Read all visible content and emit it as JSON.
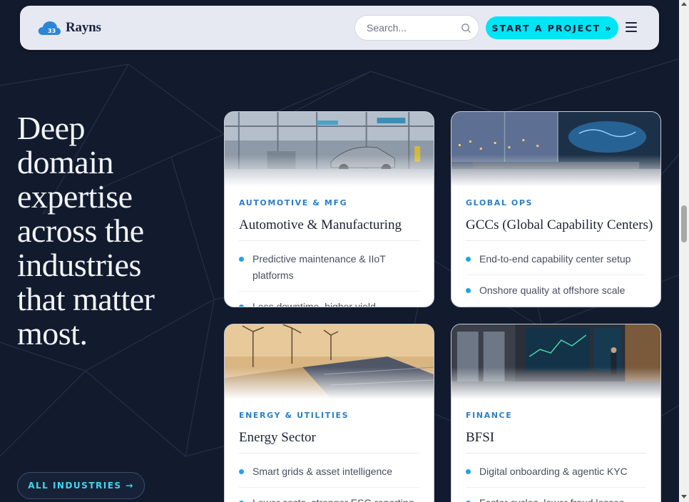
{
  "header": {
    "brand": "Rayns",
    "search_placeholder": "Search...",
    "cta_label": "START A PROJECT »",
    "menu_icon": "hamburger-menu-icon"
  },
  "hero": {
    "heading_lines": [
      "Deep",
      "domain",
      "expertise",
      "across the",
      "industries",
      "that matter",
      "most."
    ],
    "button_label": "ALL INDUSTRIES →"
  },
  "cards": [
    {
      "tag": "AUTOMOTIVE & MFG",
      "title": "Automotive & Manufacturing",
      "bullets": [
        "Predictive maintenance & IIoT platforms",
        "Less downtime, higher yield"
      ]
    },
    {
      "tag": "GLOBAL OPS",
      "title": "GCCs (Global Capability Centers)",
      "bullets": [
        "End-to-end capability center setup",
        "Onshore quality at offshore scale"
      ]
    },
    {
      "tag": "ENERGY & UTILITIES",
      "title": "Energy Sector",
      "bullets": [
        "Smart grids & asset intelligence",
        "Lower costs, stronger ESG reporting"
      ]
    },
    {
      "tag": "FINANCE",
      "title": "BFSI",
      "bullets": [
        "Digital onboarding & agentic KYC",
        "Faster cycles, lower fraud losses"
      ]
    }
  ],
  "colors": {
    "background": "#121b2e",
    "accent": "#00e5f5",
    "tag": "#2b7fc4",
    "bullet": "#1fa3e8"
  }
}
